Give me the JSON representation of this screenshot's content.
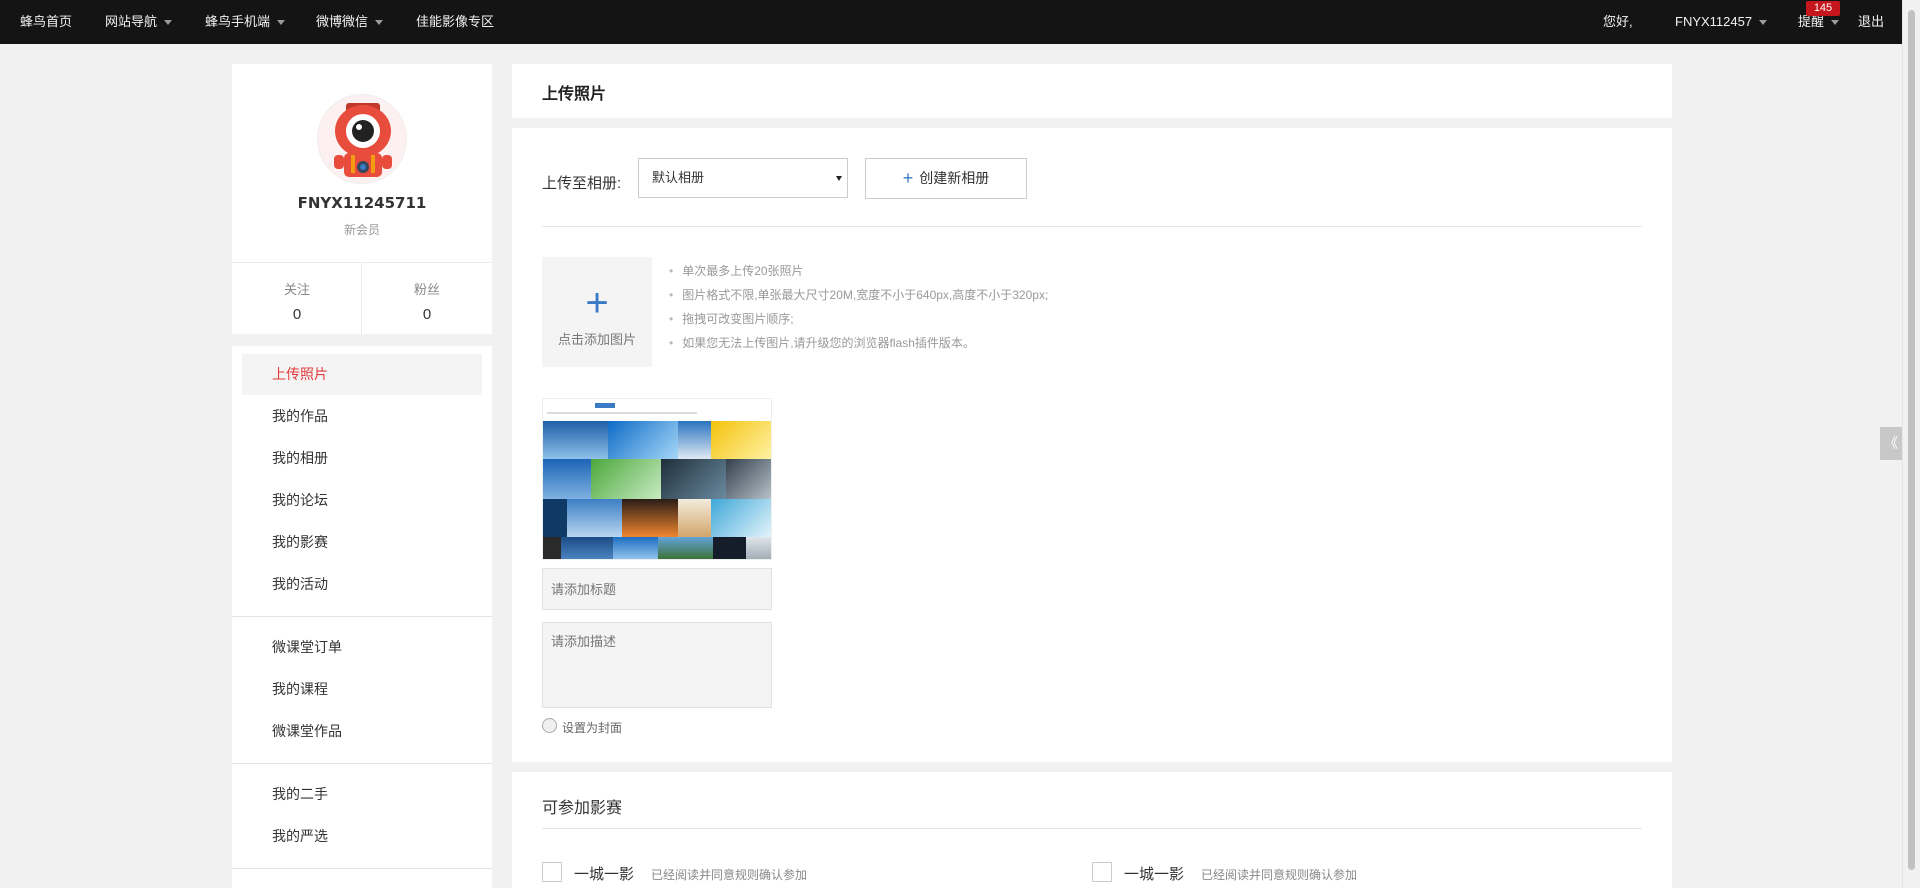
{
  "nav": {
    "home": "蜂鸟首页",
    "site_nav": "网站导航",
    "mobile": "蜂鸟手机端",
    "weibo": "微博微信",
    "canon": "佳能影像专区",
    "greeting": "您好,",
    "user": "FNYX112457",
    "remind": "提醒",
    "remind_count": "145",
    "logout": "退出"
  },
  "side_tab_icon": "《",
  "profile": {
    "username": "FNYX11245711",
    "level": "新会员",
    "follow_label": "关注",
    "follow_count": "0",
    "fans_label": "粉丝",
    "fans_count": "0"
  },
  "menu": [
    {
      "label": "上传照片",
      "active": true
    },
    {
      "label": "我的作品"
    },
    {
      "label": "我的相册"
    },
    {
      "label": "我的论坛"
    },
    {
      "label": "我的影赛"
    },
    {
      "label": "我的活动"
    },
    {
      "label": "微课堂订单"
    },
    {
      "label": "我的课程"
    },
    {
      "label": "微课堂作品"
    },
    {
      "label": "我的二手"
    },
    {
      "label": "我的严选"
    }
  ],
  "page_title": "上传照片",
  "upload": {
    "album_label": "上传至相册:",
    "album_selected": "默认相册",
    "new_album_label": "创建新相册",
    "add_plus": "+",
    "add_label": "点击添加图片",
    "tips": [
      "单次最多上传20张照片",
      "图片格式不限,单张最大尺寸20M,宽度不小于640px,高度不小于320px;",
      "拖拽可改变图片顺序;",
      "如果您无法上传图片,请升级您的浏览器flash插件版本。"
    ],
    "title_placeholder": "请添加标题",
    "desc_placeholder": "请添加描述",
    "cover_label": "设置为封面"
  },
  "contests": {
    "title": "可参加影赛",
    "items": [
      {
        "name": "一城一影",
        "note": "已经阅读并同意规则确认参加"
      },
      {
        "name": "一城一影",
        "note": "已经阅读并同意规则确认参加"
      }
    ]
  },
  "colors": {
    "topbar": "#141414",
    "active_menu": "#e4393c",
    "accent_blue": "#3a7ac6",
    "badge": "#c4161c"
  }
}
